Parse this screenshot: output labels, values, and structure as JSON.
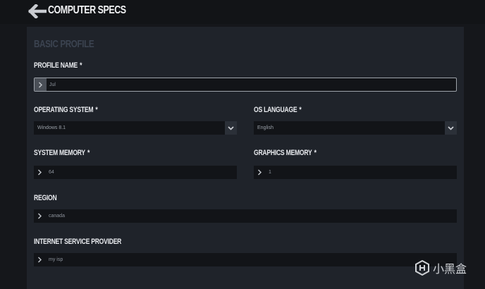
{
  "header": {
    "title": "COMPUTER SPECS",
    "back_icon": "arrow-left-icon"
  },
  "section": {
    "title": "BASIC PROFILE"
  },
  "fields": {
    "profile_name": {
      "label": "PROFILE NAME",
      "required": "*",
      "value": "Jul"
    },
    "operating_system": {
      "label": "OPERATING SYSTEM",
      "required": "*",
      "value": "Windows 8.1"
    },
    "os_language": {
      "label": "OS LANGUAGE",
      "required": "*",
      "value": "English"
    },
    "system_memory": {
      "label": "SYSTEM MEMORY",
      "required": "*",
      "value": "64"
    },
    "graphics_memory": {
      "label": "GRAPHICS MEMORY",
      "required": "*",
      "value": "1"
    },
    "region": {
      "label": "REGION",
      "value": "canada"
    },
    "isp": {
      "label": "INTERNET SERVICE PROVIDER",
      "value": "my isp"
    }
  },
  "watermark": {
    "text": "小黑盒"
  },
  "colors": {
    "background": "#15171b",
    "panel": "#1f232a",
    "field": "#121418",
    "section_title": "#3b4350"
  }
}
